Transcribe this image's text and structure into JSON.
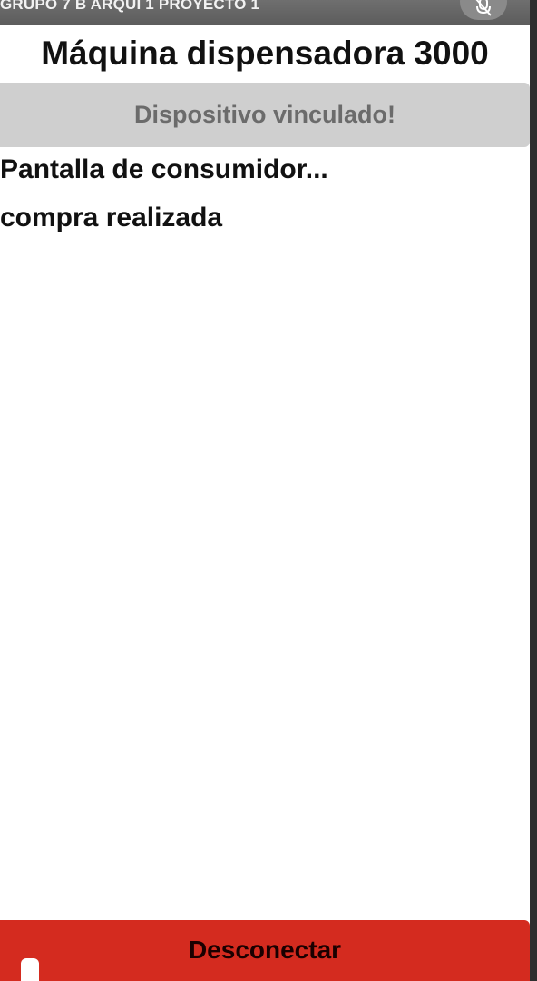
{
  "window": {
    "title": "GRUPO 7 B ARQUI 1 PROYECTO 1",
    "action_icon": "microphone-off-icon"
  },
  "main": {
    "title": "Máquina dispensadora 3000",
    "status_banner": "Dispositivo vinculado!",
    "lines": [
      "Pantalla de consumidor...",
      "compra realizada"
    ]
  },
  "footer": {
    "disconnect_label": "Desconectar"
  },
  "colors": {
    "titlebar": "#5c5c5c",
    "banner_bg": "#cfcfcf",
    "banner_text": "#6b6b6b",
    "disconnect_bg": "#d42b1f",
    "text": "#111111"
  }
}
